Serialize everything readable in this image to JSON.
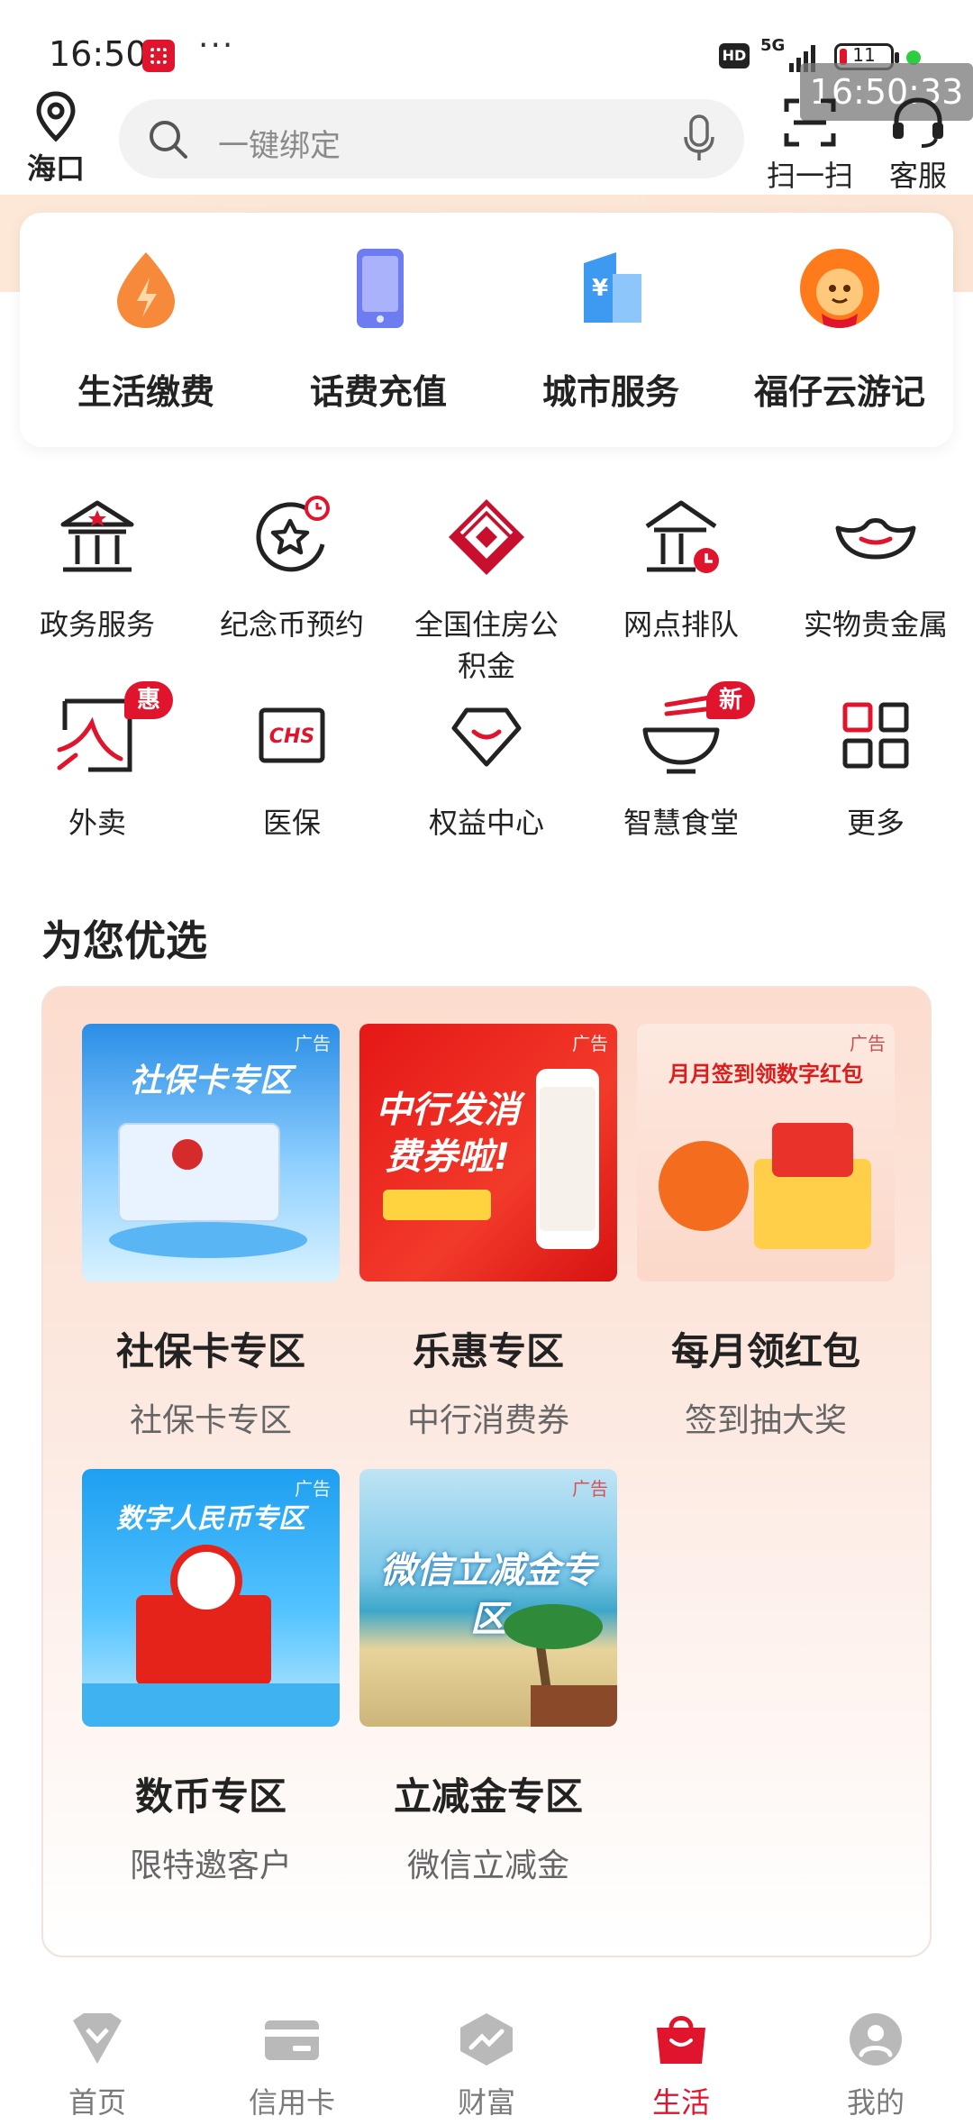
{
  "status_bar": {
    "time": "16:50",
    "dots": "···",
    "hd": "HD",
    "network": "5G",
    "battery": "11",
    "time_overlay": "16:50:33"
  },
  "header": {
    "location": "海口",
    "search_placeholder": "一键绑定",
    "scan_label": "扫一扫",
    "service_label": "客服"
  },
  "top_services": [
    {
      "label": "生活缴费",
      "icon": "fire-drop-icon"
    },
    {
      "label": "话费充值",
      "icon": "phone-icon"
    },
    {
      "label": "城市服务",
      "icon": "city-building-icon"
    },
    {
      "label": "福仔云游记",
      "icon": "mascot-icon"
    }
  ],
  "services": [
    {
      "label": "政务服务",
      "icon": "government-building-icon"
    },
    {
      "label": "纪念币预约",
      "icon": "coin-star-icon"
    },
    {
      "label": "全国住房公积金",
      "icon": "housing-fund-icon"
    },
    {
      "label": "网点排队",
      "icon": "bank-queue-icon"
    },
    {
      "label": "实物贵金属",
      "icon": "gold-ingot-icon"
    },
    {
      "label": "外卖",
      "icon": "takeout-icon",
      "badge": "惠"
    },
    {
      "label": "医保",
      "icon": "chs-medical-icon"
    },
    {
      "label": "权益中心",
      "icon": "diamond-icon"
    },
    {
      "label": "智慧食堂",
      "icon": "canteen-bowl-icon",
      "badge": "新"
    },
    {
      "label": "更多",
      "icon": "more-grid-icon"
    }
  ],
  "section_title": "为您优选",
  "recommendations": [
    {
      "title": "社保卡专区",
      "subtitle": "社保卡专区",
      "ad": "广告",
      "thumb_text": "社保卡专区"
    },
    {
      "title": "乐惠专区",
      "subtitle": "中行消费券",
      "ad": "广告",
      "thumb_text": "中行发消费券啦!"
    },
    {
      "title": "每月领红包",
      "subtitle": "签到抽大奖",
      "ad": "广告",
      "thumb_text": "月月签到领数字红包"
    },
    {
      "title": "数币专区",
      "subtitle": "限特邀客户",
      "ad": "广告",
      "thumb_text": "数字人民币专区"
    },
    {
      "title": "立减金专区",
      "subtitle": "微信立减金",
      "ad": "广告",
      "thumb_text": "微信立减金专区"
    }
  ],
  "bottom_nav": [
    {
      "label": "首页",
      "icon": "home-icon"
    },
    {
      "label": "信用卡",
      "icon": "credit-card-icon"
    },
    {
      "label": "财富",
      "icon": "wealth-icon"
    },
    {
      "label": "生活",
      "icon": "shopping-bag-icon",
      "active": true
    },
    {
      "label": "我的",
      "icon": "profile-icon"
    }
  ],
  "colors": {
    "accent": "#e0142c",
    "panel_top": "#fcdccd"
  }
}
